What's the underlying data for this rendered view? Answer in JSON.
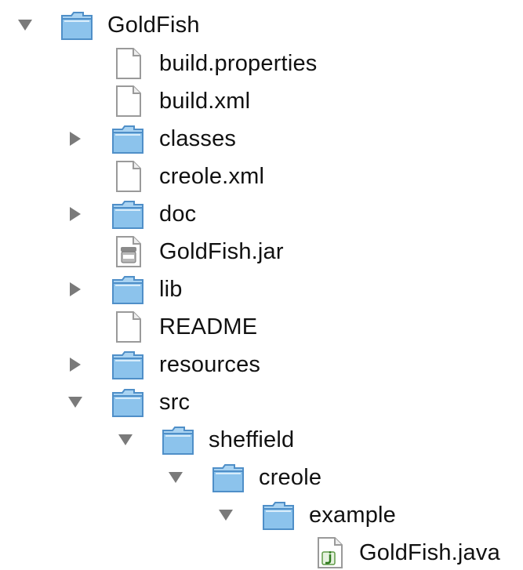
{
  "tree": {
    "items": [
      {
        "label": "GoldFish",
        "kind": "folder",
        "state": "expanded",
        "icon": "folder-icon"
      },
      {
        "label": "build.properties",
        "kind": "file",
        "state": "none",
        "icon": "document-icon"
      },
      {
        "label": "build.xml",
        "kind": "file",
        "state": "none",
        "icon": "document-icon"
      },
      {
        "label": "classes",
        "kind": "folder",
        "state": "collapsed",
        "icon": "folder-icon"
      },
      {
        "label": "creole.xml",
        "kind": "file",
        "state": "none",
        "icon": "document-icon"
      },
      {
        "label": "doc",
        "kind": "folder",
        "state": "collapsed",
        "icon": "folder-icon"
      },
      {
        "label": "GoldFish.jar",
        "kind": "file",
        "state": "none",
        "icon": "jar-file-icon"
      },
      {
        "label": "lib",
        "kind": "folder",
        "state": "collapsed",
        "icon": "folder-icon"
      },
      {
        "label": "README",
        "kind": "file",
        "state": "none",
        "icon": "document-icon"
      },
      {
        "label": "resources",
        "kind": "folder",
        "state": "collapsed",
        "icon": "folder-icon"
      },
      {
        "label": "src",
        "kind": "folder",
        "state": "expanded",
        "icon": "folder-icon"
      },
      {
        "label": "sheffield",
        "kind": "folder",
        "state": "expanded",
        "icon": "folder-icon"
      },
      {
        "label": "creole",
        "kind": "folder",
        "state": "expanded",
        "icon": "folder-icon"
      },
      {
        "label": "example",
        "kind": "folder",
        "state": "expanded",
        "icon": "folder-icon"
      },
      {
        "label": "GoldFish.java",
        "kind": "file",
        "state": "none",
        "icon": "java-file-icon"
      }
    ]
  },
  "colors": {
    "folder_body": "#8cc3ec",
    "folder_edge": "#4f8fc8",
    "triangle": "#7a7a7a",
    "text": "#111111"
  }
}
